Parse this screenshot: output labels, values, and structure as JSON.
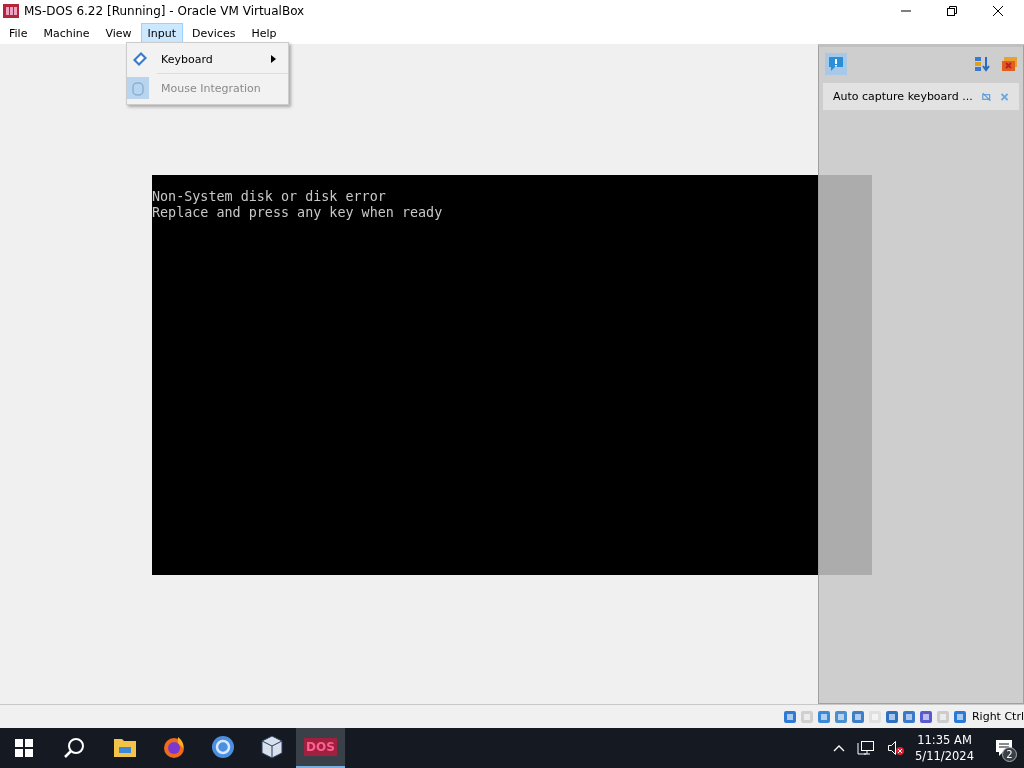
{
  "window": {
    "title": "MS-DOS 6.22 [Running] - Oracle VM VirtualBox"
  },
  "menu": [
    {
      "label": "File",
      "selected": false
    },
    {
      "label": "Machine",
      "selected": false
    },
    {
      "label": "View",
      "selected": false
    },
    {
      "label": "Input",
      "selected": true
    },
    {
      "label": "Devices",
      "selected": false
    },
    {
      "label": "Help",
      "selected": false
    }
  ],
  "dropdown": [
    {
      "label": "Keyboard",
      "submenu": true,
      "disabled": false
    },
    {
      "label": "Mouse Integration",
      "submenu": false,
      "disabled": true
    }
  ],
  "vm_screen": {
    "lines": [
      "Non-System disk or disk error",
      "Replace and press any key when ready"
    ]
  },
  "notification_panel": {
    "message": "Auto capture keyboard ..."
  },
  "status_bar": {
    "host_key": "Right Ctrl"
  },
  "taskbar": {
    "apps": [
      {
        "kind": "folder",
        "selected": false
      },
      {
        "kind": "firefox",
        "selected": false
      },
      {
        "kind": "chrome",
        "selected": false
      },
      {
        "kind": "cube",
        "selected": false
      },
      {
        "kind": "dos",
        "label": "DOS",
        "selected": true
      }
    ],
    "time": "11:35 AM",
    "date": "5/11/2024",
    "notifications": "2"
  }
}
